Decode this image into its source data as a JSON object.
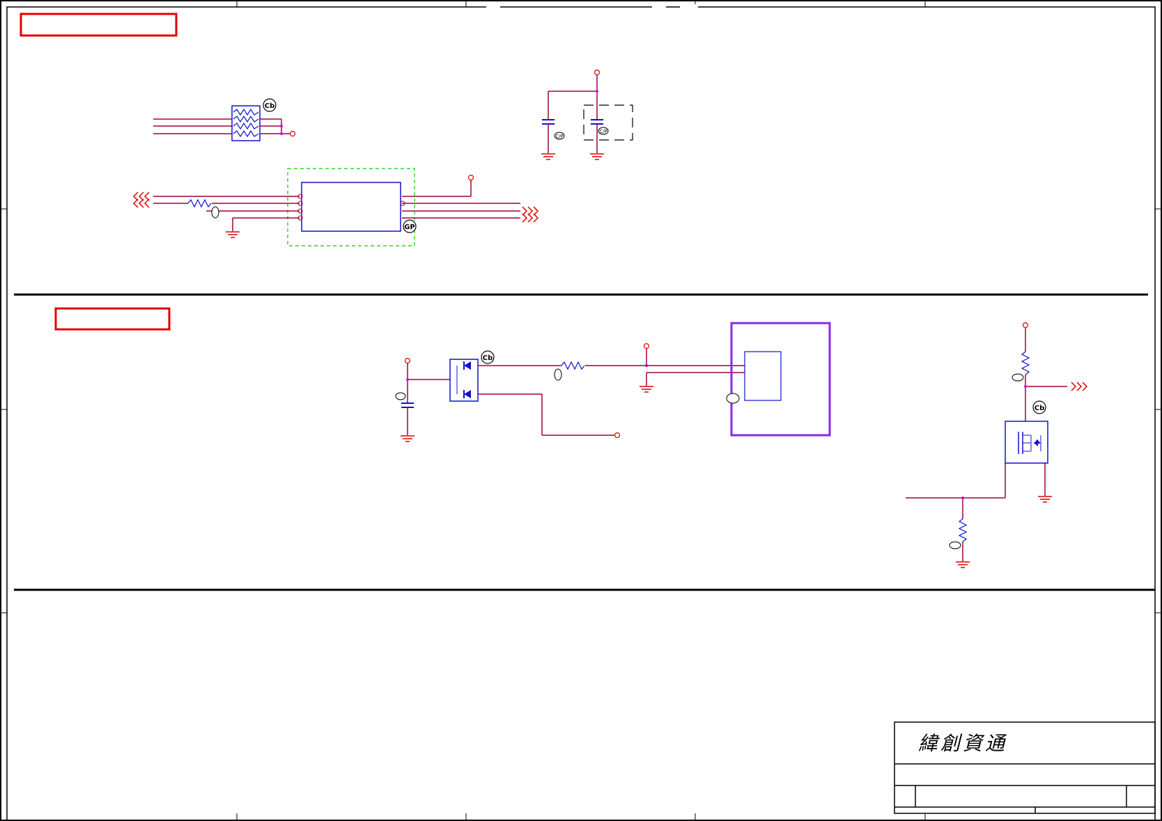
{
  "title_block": {
    "company": "緯創資通"
  },
  "colors": {
    "wire": "#a0003c",
    "component": "#1010d0",
    "power": "#e00000",
    "junction": "#e000e0",
    "frame": "#000000",
    "section_label": "#e00000",
    "keepout": "#00cc00",
    "module_outline": "#8a2be2"
  },
  "symbols": {
    "capacitor_tag": "C/P",
    "component_tag": "Cb",
    "ic_tag": "GP"
  }
}
